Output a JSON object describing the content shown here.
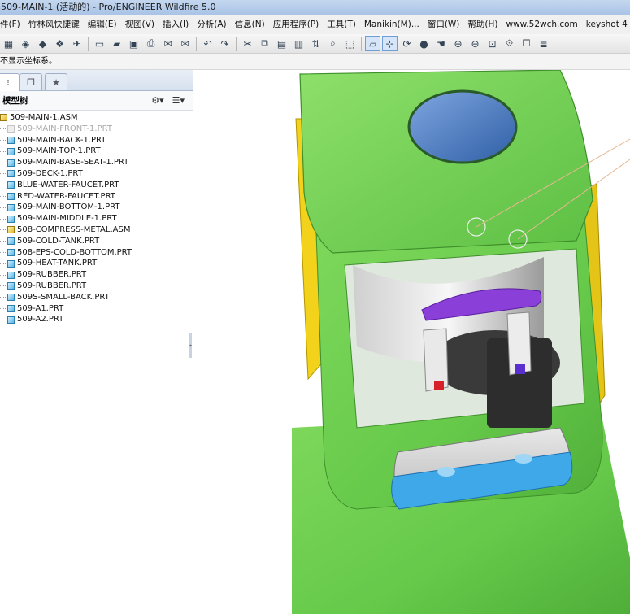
{
  "window": {
    "title": "509-MAIN-1 (活动的) - Pro/ENGINEER Wildfire 5.0"
  },
  "menu": [
    "件(F)",
    "竹林风快捷键",
    "编辑(E)",
    "视图(V)",
    "插入(I)",
    "分析(A)",
    "信息(N)",
    "应用程序(P)",
    "工具(T)",
    "Manikin(M)...",
    "窗口(W)",
    "帮助(H)",
    "www.52wch.com",
    "keyshot 4"
  ],
  "message": "不显示坐标系。",
  "panel": {
    "tabs": [
      "model-tree-tab-icon",
      "folder-browser-tab-icon",
      "favorites-tab-icon"
    ],
    "tree_title": "模型树",
    "settings_icon": "settings-icon",
    "show_icon": "show-icon"
  },
  "tree": [
    {
      "label": "509-MAIN-1.ASM",
      "type": "asm",
      "level": 0,
      "dim": false
    },
    {
      "label": "509-MAIN-FRONT-1.PRT",
      "type": "prt",
      "level": 1,
      "dim": true
    },
    {
      "label": "509-MAIN-BACK-1.PRT",
      "type": "prt",
      "level": 1,
      "dim": false
    },
    {
      "label": "509-MAIN-TOP-1.PRT",
      "type": "prt",
      "level": 1,
      "dim": false
    },
    {
      "label": "509-MAIN-BASE-SEAT-1.PRT",
      "type": "prt",
      "level": 1,
      "dim": false
    },
    {
      "label": "509-DECK-1.PRT",
      "type": "prt",
      "level": 1,
      "dim": false
    },
    {
      "label": "BLUE-WATER-FAUCET.PRT",
      "type": "prt",
      "level": 1,
      "dim": false
    },
    {
      "label": "RED-WATER-FAUCET.PRT",
      "type": "prt",
      "level": 1,
      "dim": false
    },
    {
      "label": "509-MAIN-BOTTOM-1.PRT",
      "type": "prt",
      "level": 1,
      "dim": false
    },
    {
      "label": "509-MAIN-MIDDLE-1.PRT",
      "type": "prt",
      "level": 1,
      "dim": false
    },
    {
      "label": "508-COMPRESS-METAL.ASM",
      "type": "asm",
      "level": 1,
      "dim": false
    },
    {
      "label": "509-COLD-TANK.PRT",
      "type": "prt",
      "level": 1,
      "dim": false
    },
    {
      "label": "508-EPS-COLD-BOTTOM.PRT",
      "type": "prt",
      "level": 1,
      "dim": false
    },
    {
      "label": "509-HEAT-TANK.PRT",
      "type": "prt",
      "level": 1,
      "dim": false
    },
    {
      "label": "509-RUBBER.PRT",
      "type": "prt",
      "level": 1,
      "dim": false
    },
    {
      "label": "509-RUBBER.PRT",
      "type": "prt",
      "level": 1,
      "dim": false
    },
    {
      "label": "509S-SMALL-BACK.PRT",
      "type": "prt",
      "level": 1,
      "dim": false
    },
    {
      "label": "509-A1.PRT",
      "type": "prt",
      "level": 1,
      "dim": false
    },
    {
      "label": "509-A2.PRT",
      "type": "prt",
      "level": 1,
      "dim": false
    }
  ],
  "toolbar_icons": [
    "new-icon",
    "open-icon",
    "save-icon",
    "print-icon",
    "email-icon",
    "undo-icon",
    "redo-icon",
    "cut-icon",
    "copy-icon",
    "paste-icon",
    "paste-special-icon",
    "regenerate-icon",
    "find-icon",
    "select-box-icon",
    "repaint-icon",
    "spin-center-icon",
    "orient-icon",
    "display-style-icon",
    "pan-icon",
    "zoom-in-icon",
    "zoom-out-icon",
    "refit-icon",
    "view-manager-icon",
    "saved-views-icon",
    "layers-icon"
  ],
  "colors": {
    "housing": "#6fcf4f",
    "yellow": "#f2d21b",
    "purple": "#8a3fd8",
    "blue_tray": "#3fa8e8",
    "titlebar": "#b8cfec"
  }
}
